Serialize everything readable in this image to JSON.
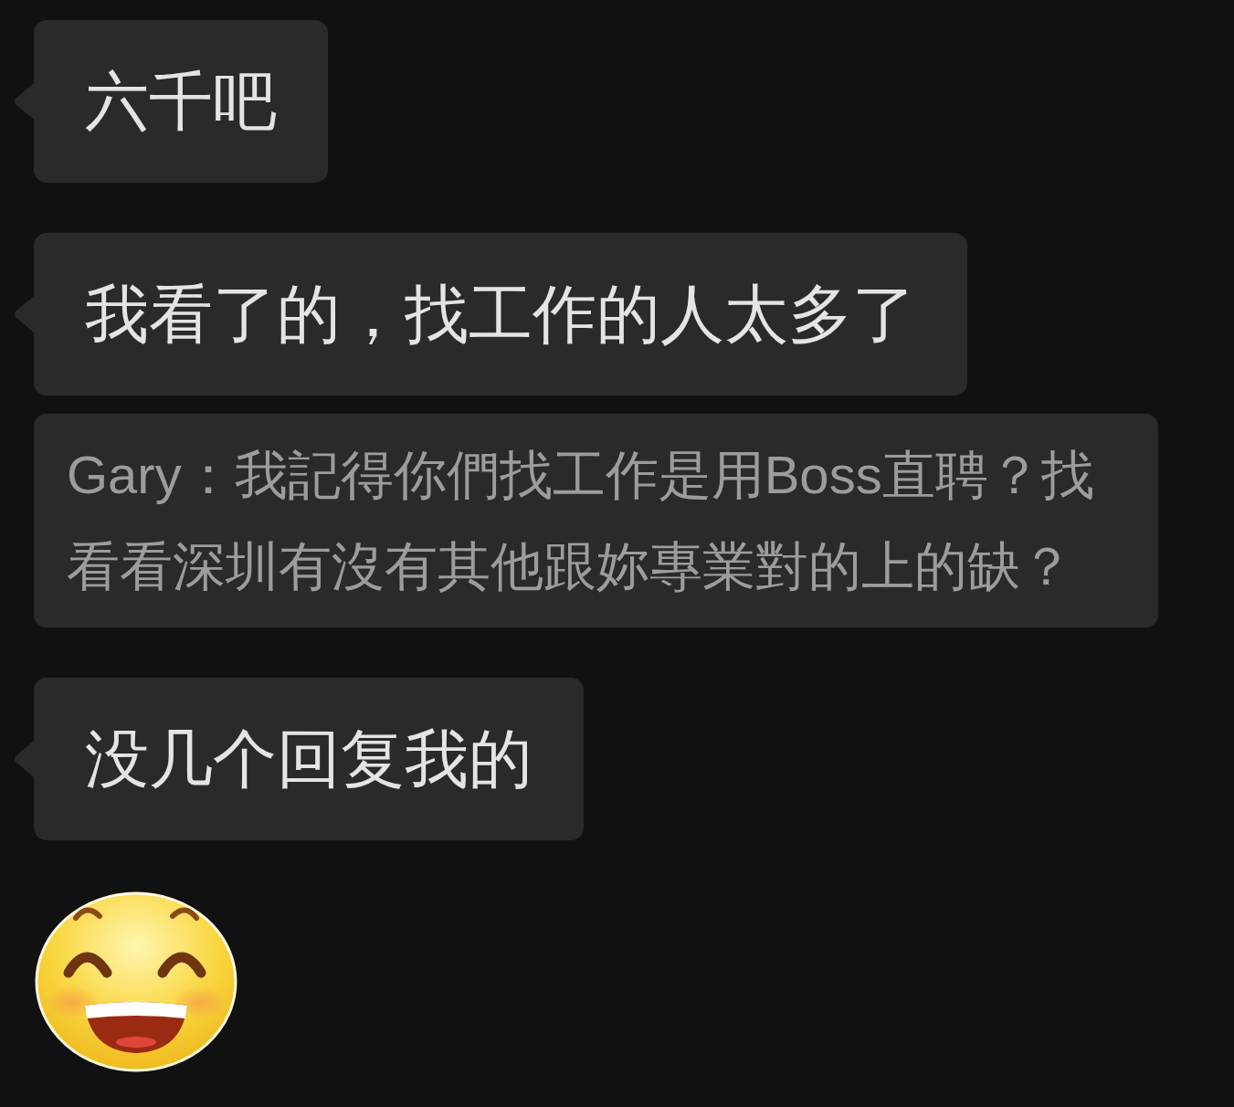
{
  "messages": [
    {
      "kind": "text",
      "text": "六千吧"
    },
    {
      "kind": "text",
      "text": "我看了的，找工作的人太多了",
      "quote": "Gary：我記得你們找工作是用Boss直聘？找看看深圳有沒有其他跟妳專業對的上的缺？"
    },
    {
      "kind": "text",
      "text": "没几个回复我的"
    },
    {
      "kind": "sticker"
    }
  ]
}
